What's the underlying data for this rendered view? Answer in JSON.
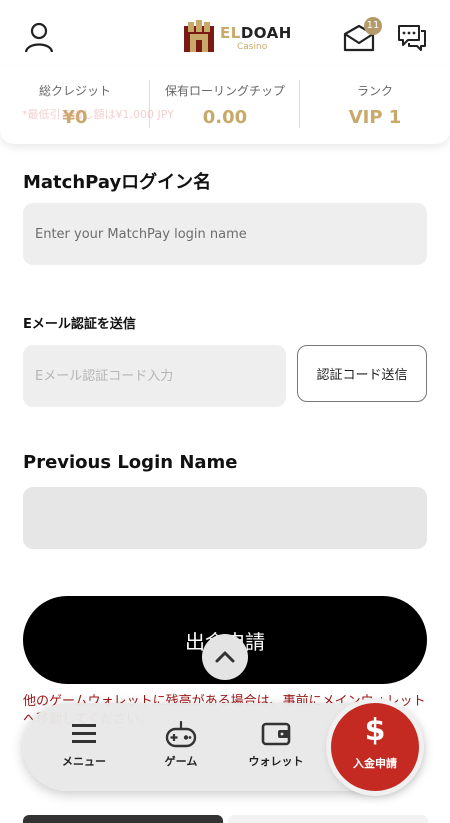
{
  "header": {
    "logo_text_a": "EL",
    "logo_text_b": "DOAH",
    "logo_sub": "Casino",
    "mail_badge": "11"
  },
  "stats": [
    {
      "label": "総クレジット",
      "value": "¥0"
    },
    {
      "label": "保有ローリングチップ",
      "value": "0.00"
    },
    {
      "label": "ランク",
      "value": "VIP 1"
    }
  ],
  "faint_note": "*最低引き出し額は¥1,000 JPY",
  "form": {
    "matchpay_title": "MatchPayログイン名",
    "matchpay_placeholder": "Enter your MatchPay login name",
    "email_title": "Eメール認証を送信",
    "email_placeholder": "Eメール認証コード入力",
    "send_code_label": "認証コード送信",
    "previous_title": "Previous Login Name",
    "previous_value": "",
    "submit_label": "出金申請"
  },
  "warning": "他のゲームウォレットに残高がある場合は、事前にメインウォレットへ移動してください。",
  "bottom_nav": {
    "items": [
      {
        "label": "メニュー",
        "icon": "menu-icon"
      },
      {
        "label": "ゲーム",
        "icon": "gamepad-icon"
      },
      {
        "label": "ウォレット",
        "icon": "wallet-icon"
      }
    ],
    "deposit_label": "入金申請",
    "deposit_symbol": "$"
  },
  "colors": {
    "gold": "#c8a96a",
    "deposit_red": "#c42a22",
    "warning_red": "#a01818"
  }
}
